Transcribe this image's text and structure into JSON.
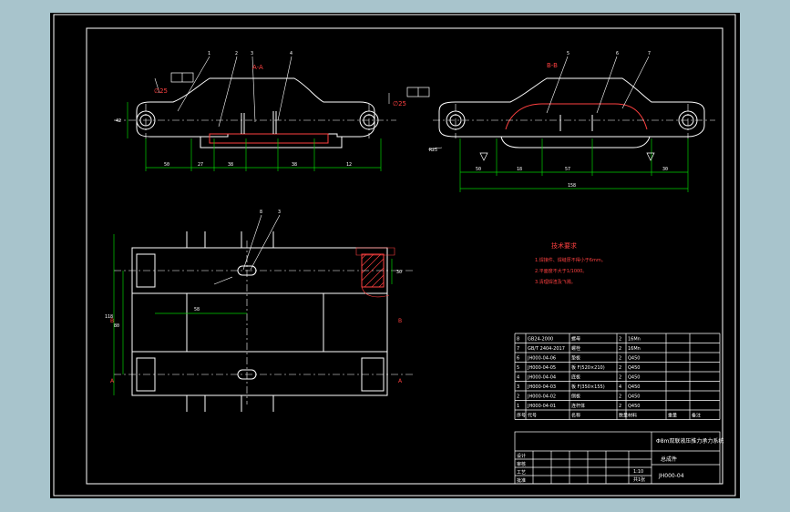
{
  "colors": {
    "background": "#a8c4cc",
    "sheet": "#000000",
    "outline": "#ffffff",
    "dimension": "#00d000",
    "centerline": "#ffffff",
    "section_text": "#ff4040",
    "leader": "#ffffff",
    "hatch": "#ff4040",
    "blue": "#4060ff"
  },
  "views": {
    "section_a": {
      "label": "A-A"
    },
    "section_b": {
      "label": "B-B"
    },
    "plan_markers": {
      "b_top": "B",
      "b_bottom": "B",
      "a_top": "A",
      "a_bottom": "A"
    }
  },
  "dimensions": {
    "left": [
      "50",
      "27",
      "38",
      "38",
      "12"
    ],
    "left_height": "42",
    "right": [
      "50",
      "18",
      "57",
      "30"
    ],
    "right_overall": "158",
    "right_radius": "R25",
    "plan_height_1": "118",
    "plan_height_2": "80",
    "plan_width": "58",
    "plan_side": "30"
  },
  "callouts": {
    "left_numbers": [
      "1",
      "2",
      "3",
      "4"
    ],
    "right_numbers": [
      "5",
      "6",
      "7"
    ],
    "plan_numbers": [
      "8",
      "3"
    ]
  },
  "tech_requirements": {
    "title": "技术要求",
    "items": [
      "1.焊接件、焊缝厚不得小于6mm。",
      "2.平面度不大于1/1000。",
      "3.清理焊渣及飞溅。"
    ]
  },
  "bom": {
    "rows": [
      {
        "no": "8",
        "code": "GB24-2000",
        "name": "螺母",
        "qty": "2",
        "material": "16Mn"
      },
      {
        "no": "7",
        "code": "GB/T 2404-2017",
        "name": "螺栓",
        "qty": "2",
        "material": "16Mn"
      },
      {
        "no": "6",
        "code": "JH000-04-06",
        "name": "垫板",
        "qty": "2",
        "material": "Q450"
      },
      {
        "no": "5",
        "code": "JH000-04-05",
        "name": "板 F(520×210)",
        "qty": "2",
        "material": "Q450"
      },
      {
        "no": "4",
        "code": "JH000-04-04",
        "name": "底板",
        "qty": "2",
        "material": "Q450"
      },
      {
        "no": "3",
        "code": "JH000-04-03",
        "name": "板 F(350×155)",
        "qty": "4",
        "material": "Q450"
      },
      {
        "no": "2",
        "code": "JH000-04-02",
        "name": "侧板",
        "qty": "2",
        "material": "Q450"
      },
      {
        "no": "1",
        "code": "JH000-04-01",
        "name": "连杆体",
        "qty": "2",
        "material": "Q450"
      }
    ],
    "header": {
      "no": "序号",
      "code": "代号",
      "name": "名称",
      "qty": "数量",
      "material": "材料",
      "weight": "重量",
      "remarks": "备注"
    },
    "title_block": {
      "title": "Φ8m双联液压推力承力系统",
      "part_name": "总成件",
      "drawing_no": "JH000-04",
      "scale": "1:10",
      "sheet": "共1张",
      "label_design": "设计",
      "label_check": "审核",
      "label_approve": "批准",
      "label_process": "工艺"
    }
  }
}
